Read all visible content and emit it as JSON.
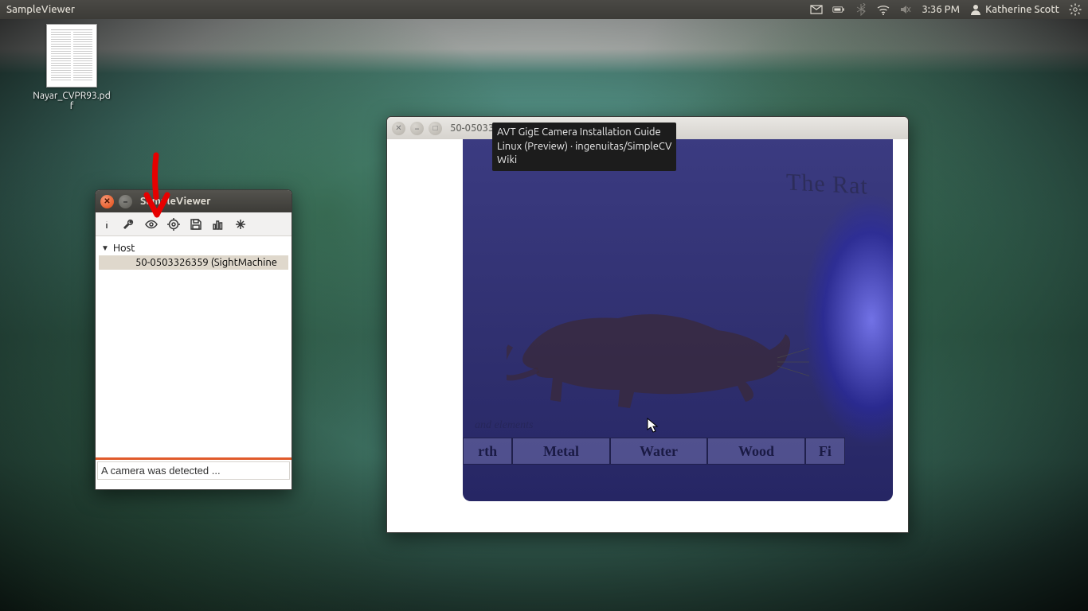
{
  "menubar": {
    "app_title": "SampleViewer",
    "clock": "3:36 PM",
    "user": "Katherine Scott"
  },
  "desktop": {
    "pdf_filename": "Nayar_CVPR93.pdf"
  },
  "sv_window": {
    "title": "SampleViewer",
    "tree_root": "Host",
    "camera_entry": "50-0503326359 (SightMachine",
    "status": "A camera was detected ..."
  },
  "cam_window": {
    "title": "50-05033",
    "mug_title": "The Rat",
    "mug_caption": "and elements",
    "labels": [
      "rth",
      "Metal",
      "Water",
      "Wood",
      "Fi"
    ]
  },
  "tooltip": {
    "line1": "AVT GigE Camera Installation Guide",
    "line2": "Linux (Preview) · ingenuitas/SimpleCV",
    "line3": "Wiki"
  }
}
